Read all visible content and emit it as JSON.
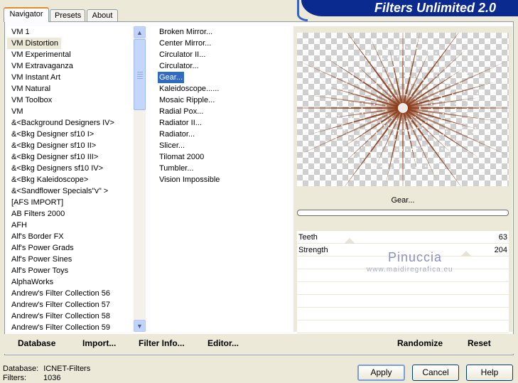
{
  "banner": {
    "title": "Filters Unlimited 2.0"
  },
  "tabs": [
    {
      "label": "Navigator",
      "active": true
    },
    {
      "label": "Presets",
      "active": false
    },
    {
      "label": "About",
      "active": false
    }
  ],
  "categories": {
    "items": [
      "VM 1",
      "VM Distortion",
      "VM Experimental",
      "VM Extravaganza",
      "VM Instant Art",
      "VM Natural",
      "VM Toolbox",
      "VM",
      "&<Background Designers IV>",
      "&<Bkg Designer sf10 I>",
      "&<Bkg Designer sf10 II>",
      "&<Bkg Designer sf10 III>",
      "&<Bkg Designers sf10 IV>",
      "&<Bkg Kaleidoscope>",
      "&<Sandflower Specials\"v\" >",
      "[AFS IMPORT]",
      "AB Filters 2000",
      "AFH",
      "Alf's Border FX",
      "Alf's Power Grads",
      "Alf's Power Sines",
      "Alf's Power Toys",
      "AlphaWorks",
      "Andrew's Filter Collection 56",
      "Andrew's Filter Collection 57",
      "Andrew's Filter Collection 58",
      "Andrew's Filter Collection 59"
    ],
    "selected_index": 1
  },
  "filters": {
    "items": [
      "Broken Mirror...",
      "Center Mirror...",
      "Circulator II...",
      "Circulator...",
      "Gear...",
      "Kaleidoscope......",
      "Mosaic Ripple...",
      "Radial Pox...",
      "Radiator II...",
      "Radiator...",
      "Slicer...",
      "Tilomat 2000",
      "Tumbler...",
      "Vision Impossible"
    ],
    "selected_index": 4
  },
  "preview": {
    "filter_name": "Gear...",
    "progress": 0,
    "ray_color": "#8b3a17"
  },
  "params": [
    {
      "name": "Teeth",
      "value": "63",
      "level": 0.247
    },
    {
      "name": "Strength",
      "value": "204",
      "level": 0.8
    }
  ],
  "watermark": {
    "name": "Pinuccia",
    "site": "www.maidiregrafica.eu"
  },
  "toolbar": {
    "database": "Database",
    "import": "Import...",
    "filter_info": "Filter Info...",
    "editor": "Editor...",
    "randomize": "Randomize",
    "reset": "Reset"
  },
  "status": {
    "database_label": "Database:",
    "database_value": "ICNET-Filters",
    "filters_label": "Filters:",
    "filters_value": "1036"
  },
  "dialog_buttons": {
    "apply": "Apply",
    "cancel": "Cancel",
    "help": "Help"
  }
}
